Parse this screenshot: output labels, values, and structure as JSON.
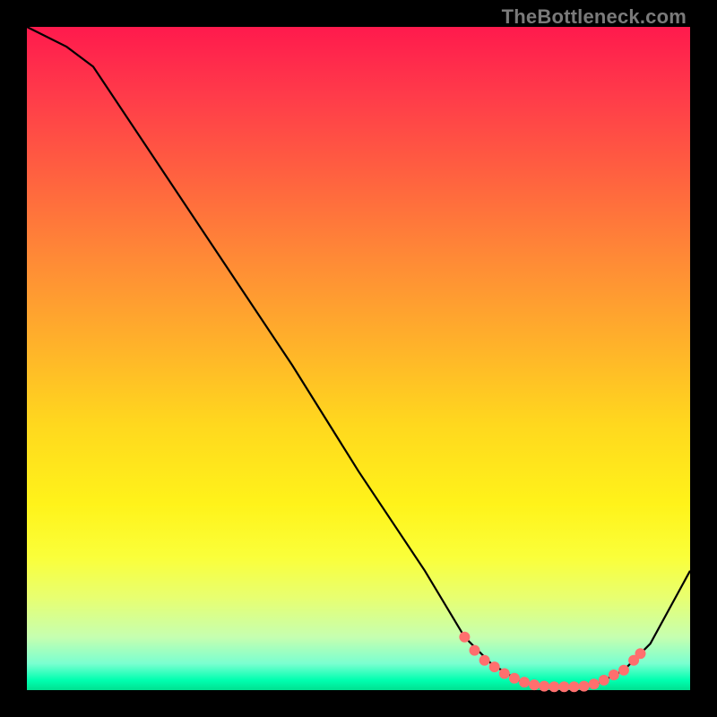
{
  "attribution": "TheBottleneck.com",
  "colors": {
    "background": "#000000",
    "attribution_text": "#7a7a7a",
    "curve_stroke": "#000000",
    "dot_fill": "#ff6f6e",
    "gradient_top": "#ff1a4d",
    "gradient_mid": "#fff31a",
    "gradient_bottom": "#00e090"
  },
  "chart_data": {
    "type": "line",
    "title": "",
    "xlabel": "",
    "ylabel": "",
    "xlim": [
      0,
      100
    ],
    "ylim": [
      0,
      100
    ],
    "grid": false,
    "series": [
      {
        "name": "bottleneck-curve",
        "x": [
          0,
          2,
          6,
          10,
          20,
          30,
          40,
          50,
          60,
          66,
          70,
          74,
          78,
          82,
          86,
          90,
          94,
          100
        ],
        "values": [
          100,
          99,
          97,
          94,
          79,
          64,
          49,
          33,
          18,
          8,
          4,
          1.5,
          0.5,
          0.5,
          1,
          3,
          7,
          18
        ]
      }
    ],
    "markers": [
      {
        "x": 66.0,
        "y": 8.0
      },
      {
        "x": 67.5,
        "y": 6.0
      },
      {
        "x": 69.0,
        "y": 4.5
      },
      {
        "x": 70.5,
        "y": 3.5
      },
      {
        "x": 72.0,
        "y": 2.5
      },
      {
        "x": 73.5,
        "y": 1.8
      },
      {
        "x": 75.0,
        "y": 1.2
      },
      {
        "x": 76.5,
        "y": 0.8
      },
      {
        "x": 78.0,
        "y": 0.6
      },
      {
        "x": 79.5,
        "y": 0.5
      },
      {
        "x": 81.0,
        "y": 0.5
      },
      {
        "x": 82.5,
        "y": 0.5
      },
      {
        "x": 84.0,
        "y": 0.6
      },
      {
        "x": 85.5,
        "y": 0.9
      },
      {
        "x": 87.0,
        "y": 1.5
      },
      {
        "x": 88.5,
        "y": 2.3
      },
      {
        "x": 90.0,
        "y": 3.0
      },
      {
        "x": 91.5,
        "y": 4.5
      },
      {
        "x": 92.5,
        "y": 5.5
      }
    ]
  }
}
